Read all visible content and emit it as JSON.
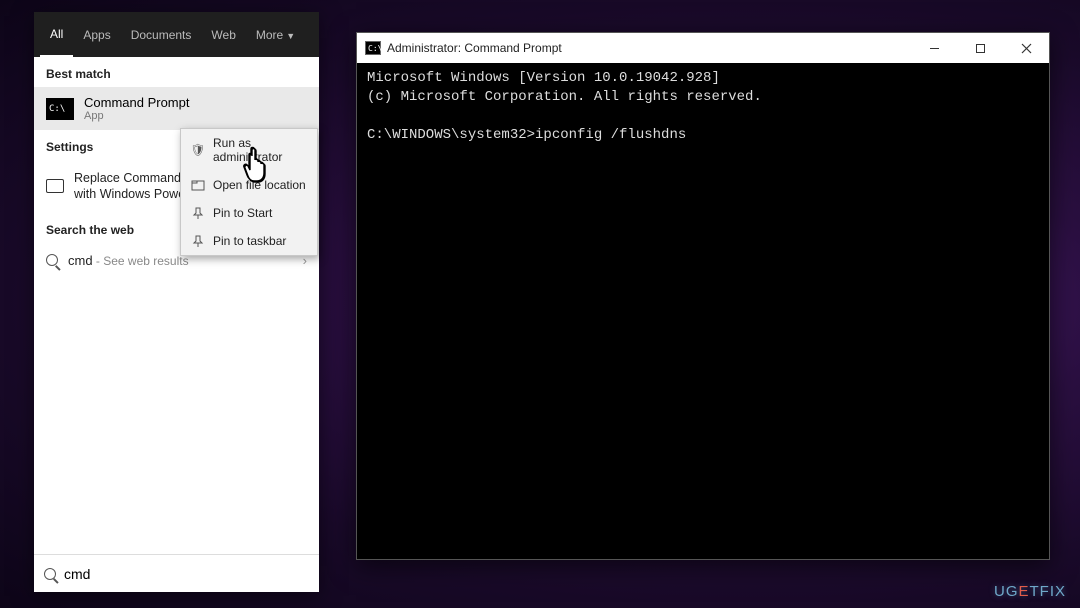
{
  "search": {
    "tabs": [
      "All",
      "Apps",
      "Documents",
      "Web",
      "More"
    ],
    "active_tab": 0,
    "sections": {
      "best_match_label": "Best match",
      "best_match": {
        "title": "Command Prompt",
        "subtitle": "App"
      },
      "settings_label": "Settings",
      "settings_item": "Replace Command Prompt with Windows PowerShell",
      "web_label": "Search the web",
      "web_query": "cmd",
      "web_hint": " - See web results"
    },
    "input_value": "cmd"
  },
  "context_menu": {
    "items": [
      {
        "icon": "shield",
        "label": "Run as administrator"
      },
      {
        "icon": "folder",
        "label": "Open file location"
      },
      {
        "icon": "pin",
        "label": "Pin to Start"
      },
      {
        "icon": "taskbar",
        "label": "Pin to taskbar"
      }
    ]
  },
  "cmd_window": {
    "title": "Administrator: Command Prompt",
    "lines": {
      "l1": "Microsoft Windows [Version 10.0.19042.928]",
      "l2": "(c) Microsoft Corporation. All rights reserved.",
      "l3": "",
      "l4": "C:\\WINDOWS\\system32>ipconfig /flushdns"
    }
  },
  "watermark": {
    "text_pre": "UG",
    "text_e": "E",
    "text_post": "TFIX"
  }
}
